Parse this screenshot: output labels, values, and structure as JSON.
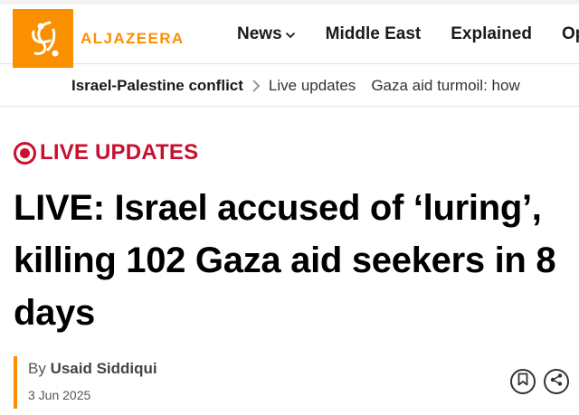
{
  "brand": {
    "name": "ALJAZEERA",
    "accent_color": "#fa9000",
    "logo_icon": "aljazeera-calligraphy-logo"
  },
  "nav": {
    "items": [
      {
        "label": "News",
        "has_dropdown": true
      },
      {
        "label": "Middle East"
      },
      {
        "label": "Explained"
      },
      {
        "label": "Op"
      }
    ]
  },
  "subnav": {
    "primary": "Israel-Palestine conflict",
    "separator_icon": "chevron-right-icon",
    "items": [
      "Live updates",
      "Gaza aid turmoil: how"
    ]
  },
  "article": {
    "badge": "LIVE UPDATES",
    "badge_color": "#c8102e",
    "headline": "LIVE: Israel accused of ‘luring’, killing 102 Gaza aid seekers in 8 days",
    "byline_prefix": "By",
    "author": "Usaid Siddiqui",
    "date": "3 Jun 2025"
  },
  "actions": {
    "bookmark_icon": "bookmark-icon",
    "share_icon": "share-icon"
  }
}
